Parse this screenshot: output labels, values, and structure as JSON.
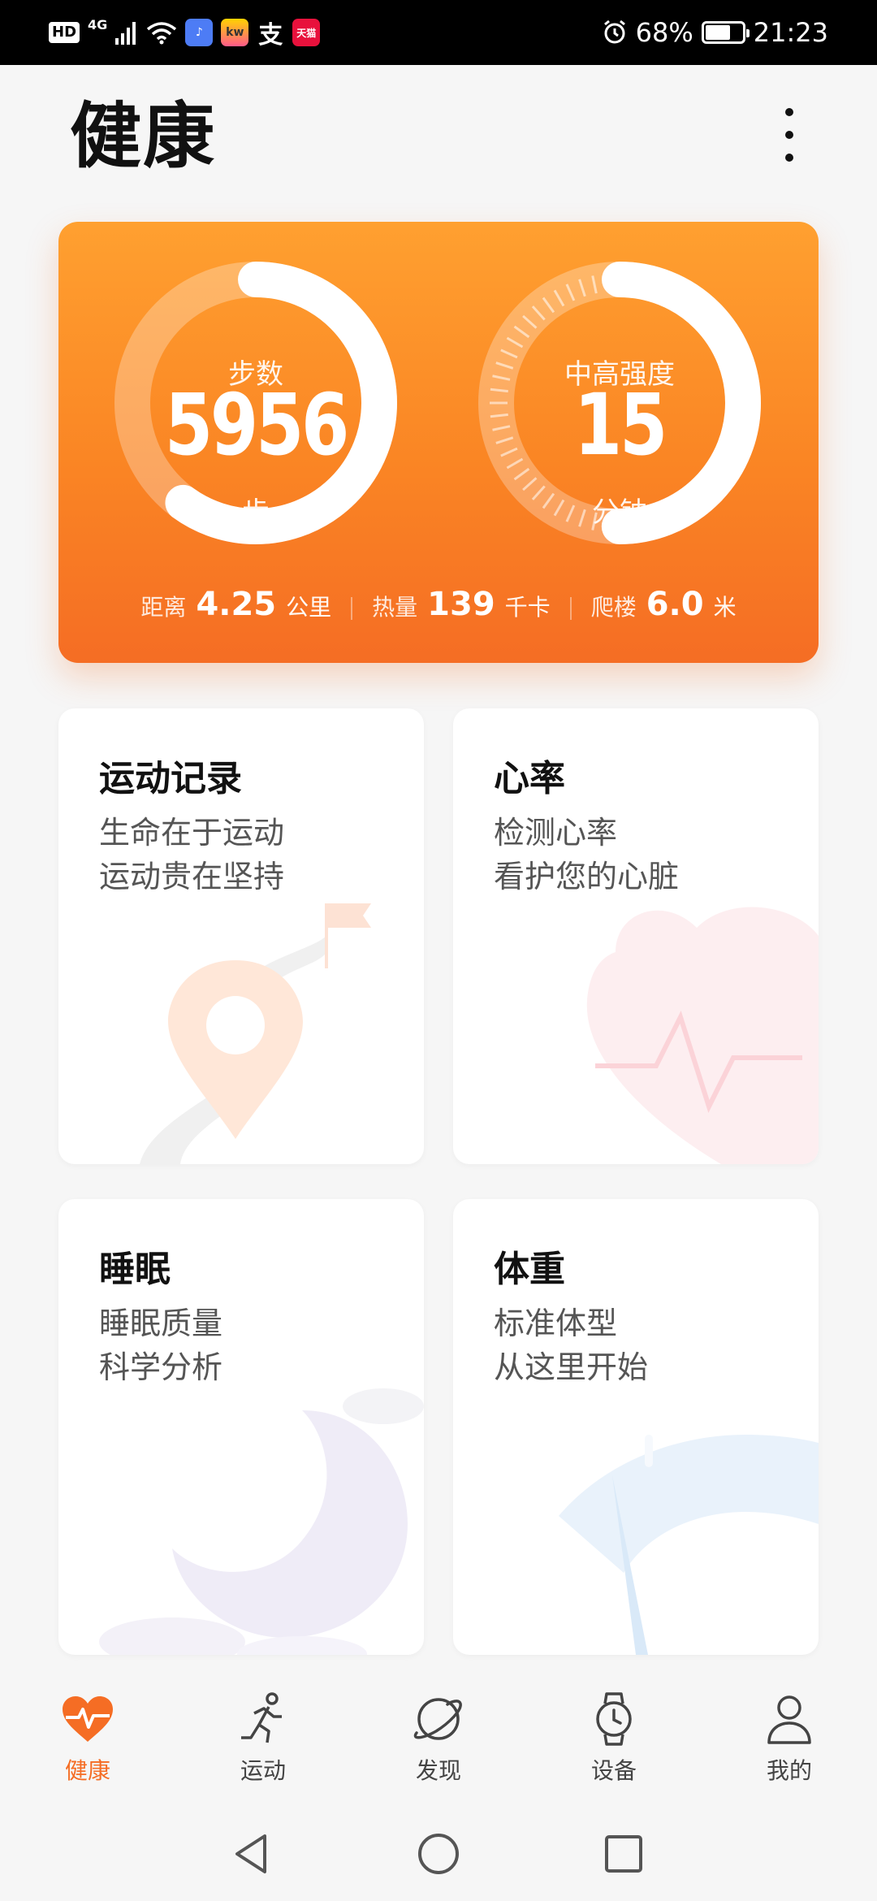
{
  "status_bar": {
    "hd": "HD",
    "network": "4G",
    "app_icons": [
      "music-app-icon",
      "kuwo-app-icon",
      "alipay-icon",
      "tmall-icon"
    ],
    "kw_label": "kw",
    "alipay_label": "支",
    "tmall_label": "天猫",
    "battery": "68%",
    "battery_level": 0.68,
    "time": "21:23"
  },
  "header": {
    "title": "健康"
  },
  "summary": {
    "steps": {
      "label": "步数",
      "value": "5956",
      "unit": "步",
      "progress": 0.6
    },
    "intensity": {
      "label": "中高强度",
      "value": "15",
      "unit": "分钟",
      "progress": 0.5
    },
    "metrics": [
      {
        "label": "距离",
        "value": "4.25",
        "unit": "公里"
      },
      {
        "label": "热量",
        "value": "139",
        "unit": "千卡"
      },
      {
        "label": "爬楼",
        "value": "6.0",
        "unit": "米"
      }
    ]
  },
  "cards": {
    "exercise": {
      "title": "运动记录",
      "line1": "生命在于运动",
      "line2": "运动贵在坚持"
    },
    "heart": {
      "title": "心率",
      "line1": "检测心率",
      "line2": "看护您的心脏"
    },
    "sleep": {
      "title": "睡眠",
      "line1": "睡眠质量",
      "line2": "科学分析"
    },
    "weight": {
      "title": "体重",
      "line1": "标准体型",
      "line2": "从这里开始"
    }
  },
  "nav": {
    "items": [
      {
        "label": "健康",
        "icon": "heart-pulse-icon",
        "active": true
      },
      {
        "label": "运动",
        "icon": "runner-icon",
        "active": false
      },
      {
        "label": "发现",
        "icon": "planet-icon",
        "active": false
      },
      {
        "label": "设备",
        "icon": "watch-icon",
        "active": false
      },
      {
        "label": "我的",
        "icon": "person-icon",
        "active": false
      }
    ]
  },
  "colors": {
    "accent": "#f56d24",
    "card_top": "#ffa030",
    "card_bottom": "#f56d24"
  }
}
